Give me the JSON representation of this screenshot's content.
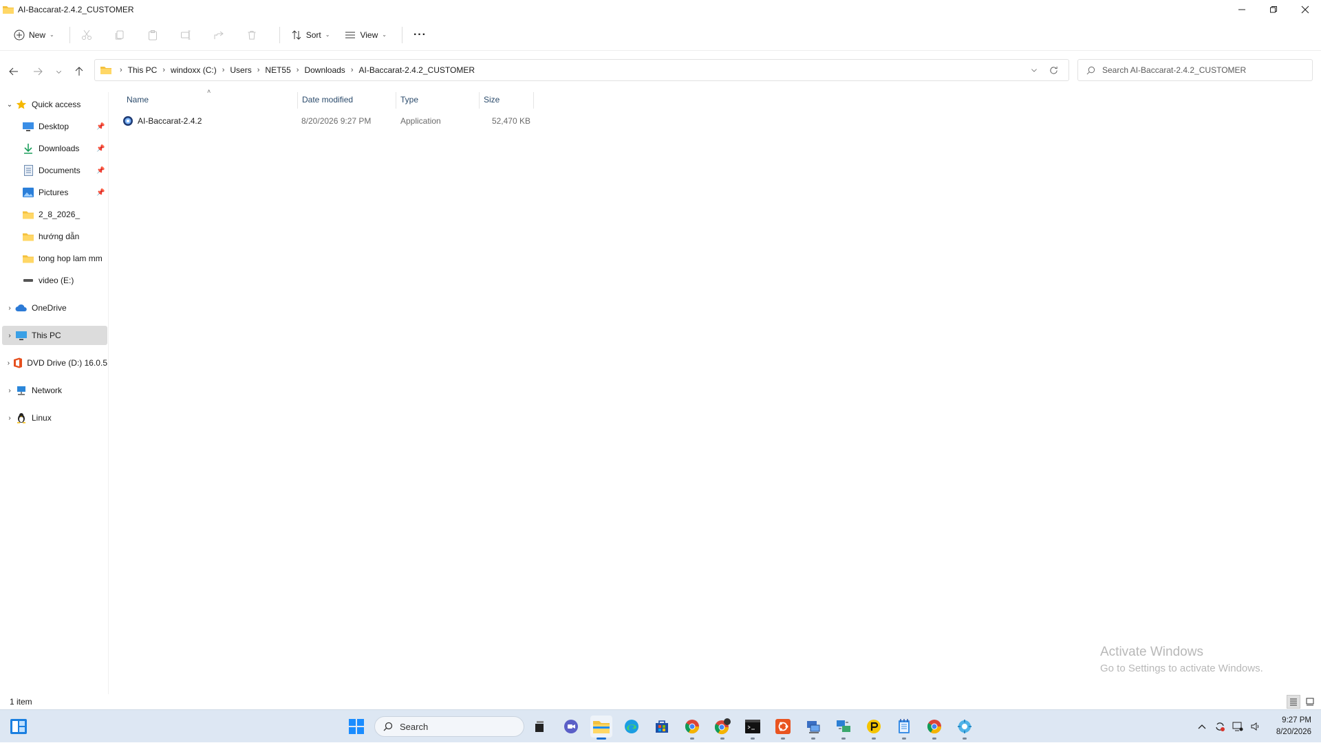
{
  "window": {
    "title": "AI-Baccarat-2.4.2_CUSTOMER"
  },
  "commandbar": {
    "new_label": "New",
    "sort_label": "Sort",
    "view_label": "View",
    "more_label": "···"
  },
  "address": {
    "crumbs": [
      "This PC",
      "windoxx (C:)",
      "Users",
      "NET55",
      "Downloads",
      "AI-Baccarat-2.4.2_CUSTOMER"
    ],
    "search_placeholder": "Search AI-Baccarat-2.4.2_CUSTOMER"
  },
  "sidebar": {
    "quick_access": "Quick access",
    "items": [
      {
        "label": "Desktop",
        "icon": "desktop-icon",
        "pinned": true
      },
      {
        "label": "Downloads",
        "icon": "download-icon",
        "pinned": true
      },
      {
        "label": "Documents",
        "icon": "documents-icon",
        "pinned": true
      },
      {
        "label": "Pictures",
        "icon": "pictures-icon",
        "pinned": true
      },
      {
        "label": "2_8_2026_",
        "icon": "folder-icon",
        "pinned": false
      },
      {
        "label": "hướng dẫn",
        "icon": "folder-icon",
        "pinned": false
      },
      {
        "label": "tong hop lam mm",
        "icon": "folder-icon",
        "pinned": false
      },
      {
        "label": "video (E:)",
        "icon": "drive-icon",
        "pinned": false
      }
    ],
    "onedrive": "OneDrive",
    "this_pc": "This PC",
    "dvd": "DVD Drive (D:) 16.0.5",
    "network": "Network",
    "linux": "Linux"
  },
  "filelist": {
    "columns": [
      "Name",
      "Date modified",
      "Type",
      "Size"
    ],
    "rows": [
      {
        "name": "AI-Baccarat-2.4.2",
        "date": "8/20/2026 9:27 PM",
        "type": "Application",
        "size": "52,470 KB"
      }
    ]
  },
  "watermark": {
    "line1": "Activate Windows",
    "line2": "Go to Settings to activate Windows."
  },
  "status": {
    "count": "1 item"
  },
  "taskbar": {
    "search_label": "Search",
    "time": "9:27 PM",
    "date": "8/20/2026"
  },
  "colors": {
    "folder": "#f4c13d",
    "accent": "#1a6fd1",
    "taskbar": "#dde7f3"
  }
}
